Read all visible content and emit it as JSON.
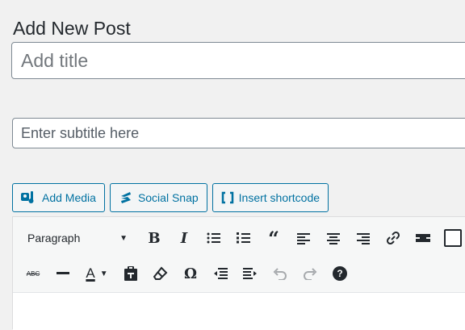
{
  "page": {
    "title": "Add New Post"
  },
  "title_field": {
    "placeholder": "Add title"
  },
  "subtitle_field": {
    "placeholder": "Enter subtitle here"
  },
  "media_buttons": {
    "add_media": "Add Media",
    "social_snap": "Social Snap",
    "insert_shortcode": "Insert shortcode"
  },
  "toolbar": {
    "format_select": "Paragraph",
    "row1_icons": [
      "bold-icon",
      "italic-icon",
      "bulleted-list-icon",
      "numbered-list-icon",
      "blockquote-icon",
      "align-left-icon",
      "align-center-icon",
      "align-right-icon",
      "link-icon",
      "read-more-icon",
      "toolbar-toggle-icon"
    ],
    "row2_icons": [
      "strikethrough-icon",
      "horizontal-line-icon",
      "text-color-icon",
      "paste-as-text-icon",
      "clear-formatting-icon",
      "special-character-icon",
      "outdent-icon",
      "indent-icon",
      "undo-icon",
      "redo-icon",
      "help-icon"
    ],
    "bold_glyph": "B",
    "italic_glyph": "I",
    "blockquote_glyph": "“",
    "text_color_glyph": "A",
    "special_char_glyph": "Ω",
    "strike_glyph": "ABC",
    "help_glyph": "?"
  },
  "colors": {
    "accent": "#0071a1",
    "background": "#f1f1f1",
    "text": "#23282d"
  }
}
